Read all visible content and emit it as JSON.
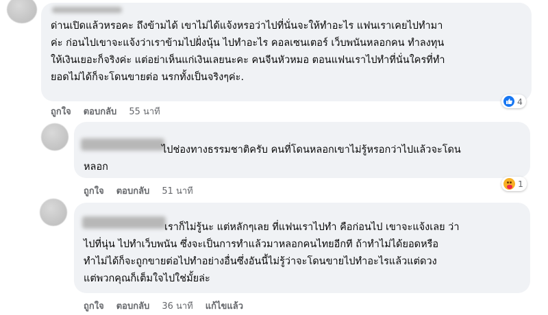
{
  "comments": [
    {
      "lines": [
        "ด่านเปิดแล้วหรอคะ ถึงข้ามได้ เขาไม่ได้แจ้งหรอว่าไปที่นั่นจะให้ทำอะไร แฟนเราเคยไปทำมา",
        "ค่ะ ก่อนไปเขาจะแจ้งว่าเราข้ามไปฝั่งนุ้น ไปทำอะไร คอลเซนเตอร์ เว็บพนันหลอกคน ทำลงทุน",
        "ให้เงินเยอะก็จริงค่ะ แต่อย่าเห็นแก่เงินเลยนะคะ คนจีนหัวหมอ ตอนแฟนเราไปทำที่นั่นใครที่ทำ",
        "ยอดไม่ได้ก็จะโดนขายต่อ นรกทั้งเป็นจริงๆค่ะ."
      ],
      "like_label": "ถูกใจ",
      "reply_label": "ตอบกลับ",
      "time": "55 นาที",
      "reaction_icon": "like-icon",
      "reaction_count": "4"
    },
    {
      "lines": [
        "ไปช่องทางธรรมชาติครับ คนที่โดนหลอกเขาไม่รู้หรอกว่าไปแล้วจะโดน",
        "หลอก"
      ],
      "like_label": "ถูกใจ",
      "reply_label": "ตอบกลับ",
      "time": "51 นาที",
      "reaction_icon": "care-icon",
      "reaction_count": "1"
    },
    {
      "lines": [
        "เราก็ไม่รู้นะ แต่หลักๆเลย ที่แฟนเราไปทำ คือก่อนไป เขาจะแจ้งเลย ว่า",
        "ไปที่นุ่น ไปทำเว็บพนัน ซึ่งจะเป็นการทำแล้วมาหลอกคนไทยอีกที ถ้าทำไม่ได้ยอดหรือ",
        "ทำไม่ได้ก็จะถูกขายต่อไปทำอย่างอื่นซึ่งอันนี้ไม่รู้ว่าจะโดนขายไปทำอะไรแล้วแต่ดวง",
        "แต่พวกคุณก็เต็มใจไปใช่มั้ยล่ะ"
      ],
      "like_label": "ถูกใจ",
      "reply_label": "ตอบกลับ",
      "time": "36 นาที",
      "edited_label": "แก้ไขแล้ว"
    }
  ]
}
